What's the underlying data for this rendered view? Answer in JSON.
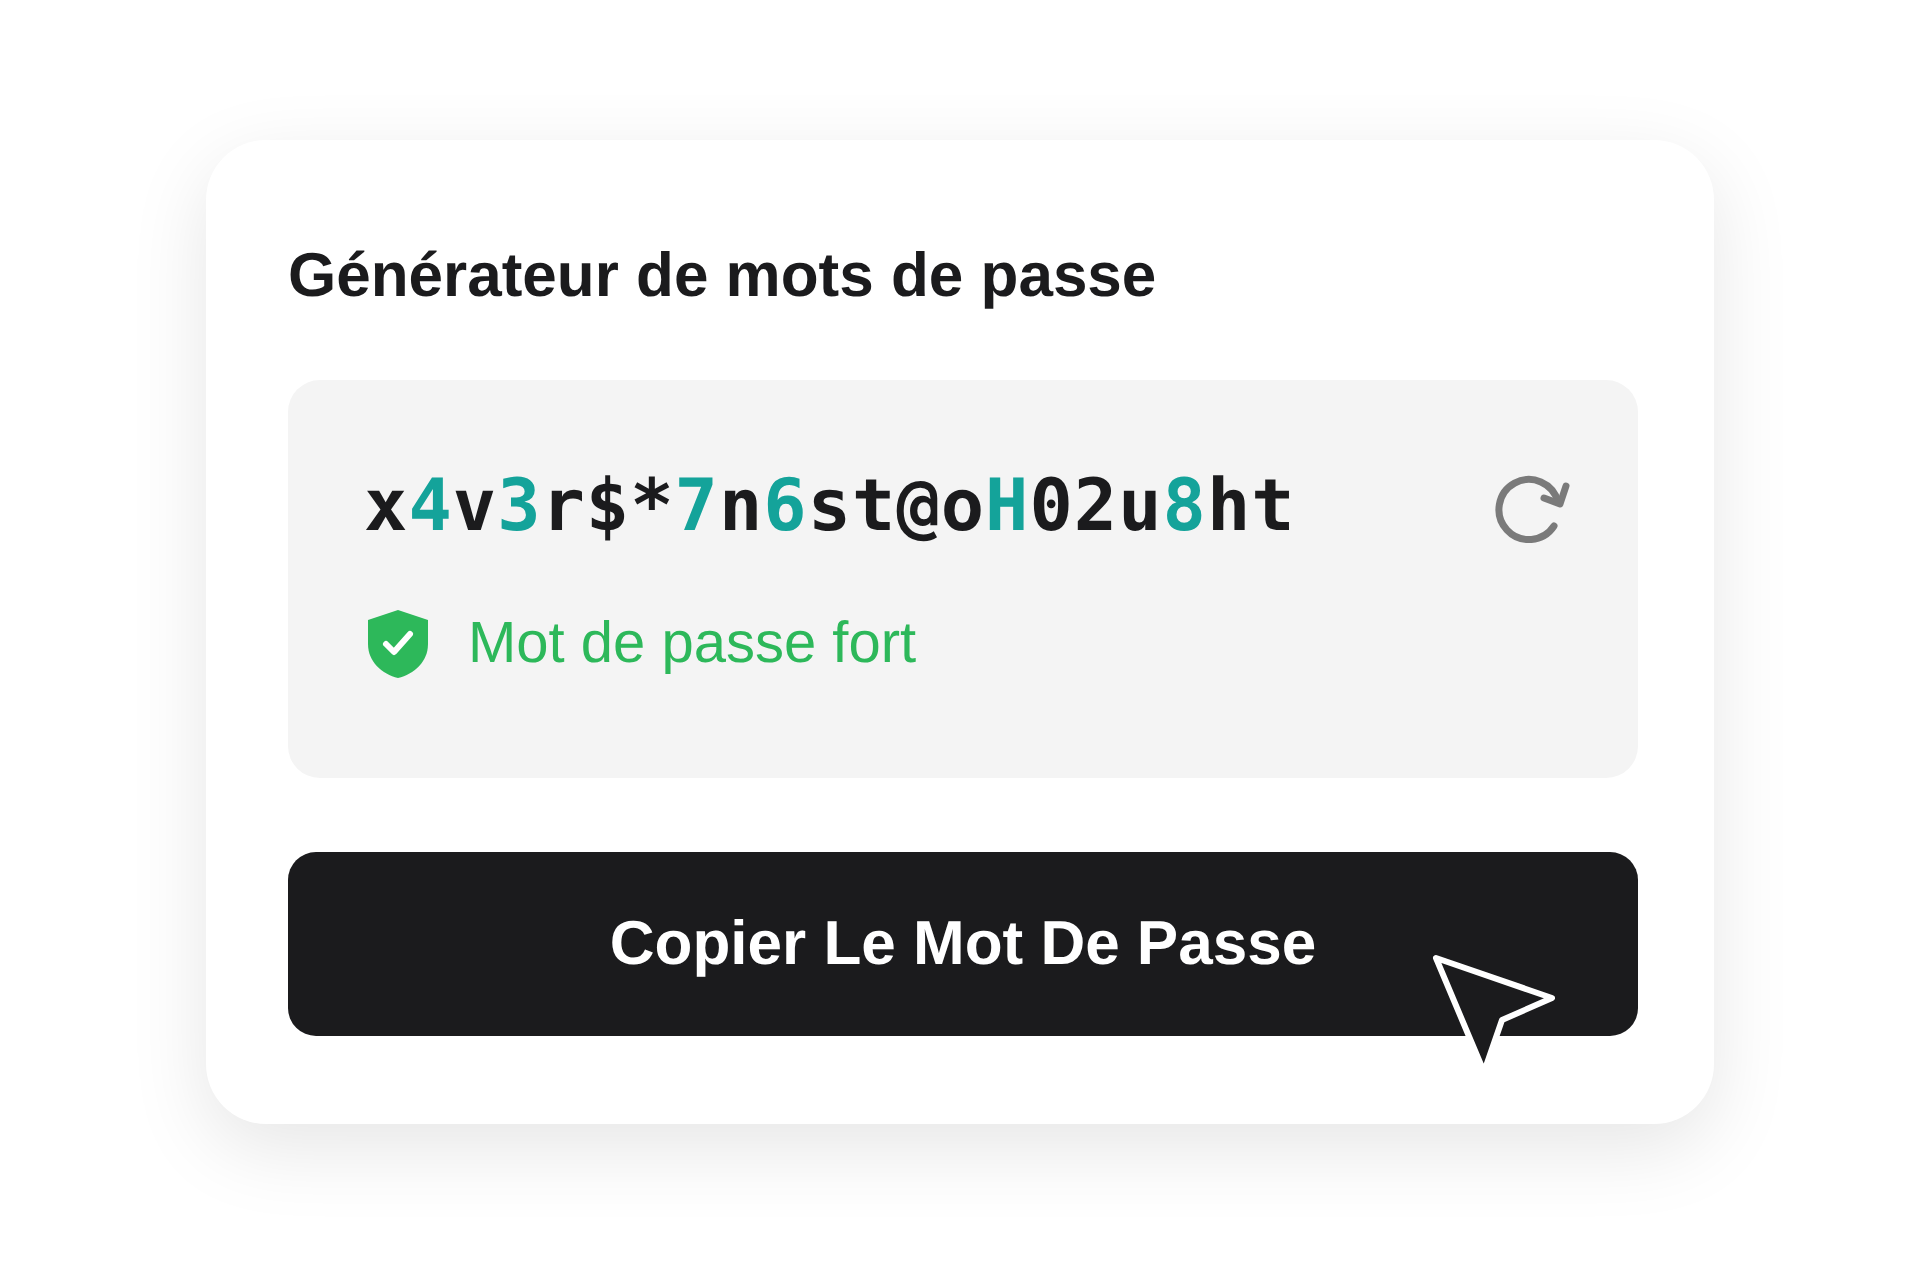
{
  "title": "Générateur de mots de passe",
  "password": [
    {
      "text": "x",
      "accent": false
    },
    {
      "text": "4",
      "accent": true
    },
    {
      "text": "v",
      "accent": false
    },
    {
      "text": "3",
      "accent": true
    },
    {
      "text": "r$*",
      "accent": false
    },
    {
      "text": "7",
      "accent": true
    },
    {
      "text": "n",
      "accent": false
    },
    {
      "text": "6",
      "accent": true
    },
    {
      "text": "st@o",
      "accent": false
    },
    {
      "text": "H",
      "accent": true
    },
    {
      "text": "02u",
      "accent": false
    },
    {
      "text": "8",
      "accent": true
    },
    {
      "text": "ht",
      "accent": false
    }
  ],
  "strength": {
    "label": "Mot de passe fort",
    "kind": "strong"
  },
  "button": "Copier Le Mot De Passe"
}
